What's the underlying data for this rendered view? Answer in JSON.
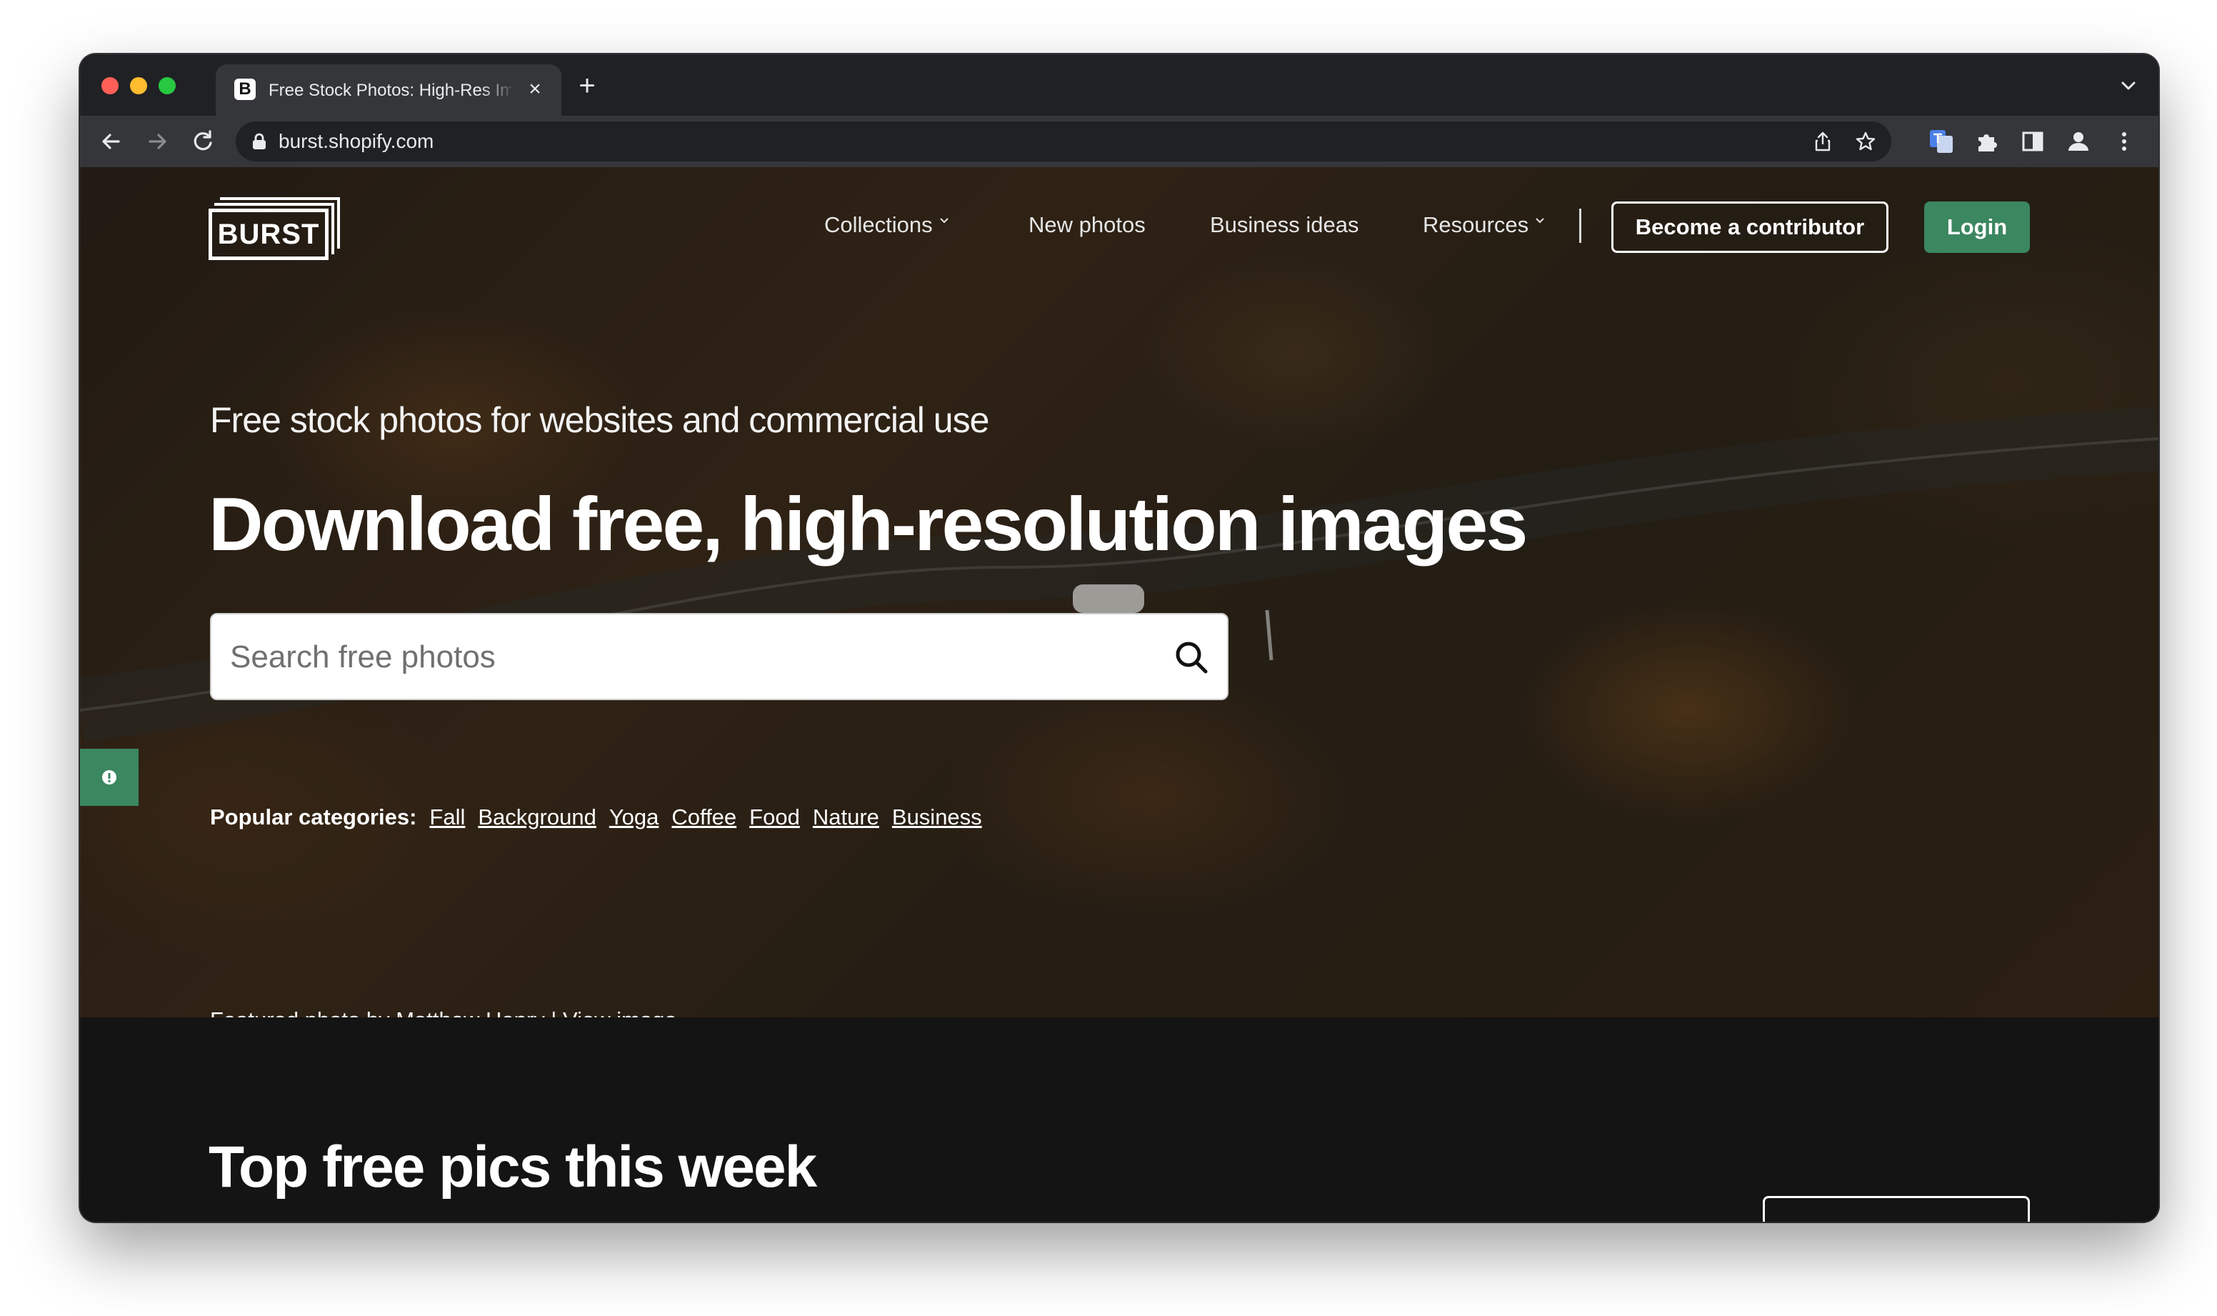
{
  "browser": {
    "tab": {
      "favicon_letter": "B",
      "title": "Free Stock Photos: High-Res Images"
    },
    "url": "burst.shopify.com"
  },
  "site": {
    "logo_text": "BURST",
    "nav": {
      "collections": "Collections",
      "new_photos": "New photos",
      "business_ideas": "Business ideas",
      "resources": "Resources",
      "contributor": "Become a contributor",
      "login": "Login"
    },
    "hero": {
      "subtitle": "Free stock photos for websites and commercial use",
      "title": "Download free, high-resolution images",
      "search_placeholder": "Search free photos",
      "categories_label": "Popular categories:",
      "categories": [
        "Fall",
        "Background",
        "Yoga",
        "Coffee",
        "Food",
        "Nature",
        "Business"
      ],
      "credit_text": "Featured photo by Matthew Henry |",
      "credit_link": "View image"
    },
    "section": {
      "title": "Top free pics this week"
    }
  },
  "colors": {
    "accent_green": "#3b8760",
    "chrome_dark": "#202124",
    "chrome_toolbar": "#35363a",
    "page_dark": "#141414"
  }
}
